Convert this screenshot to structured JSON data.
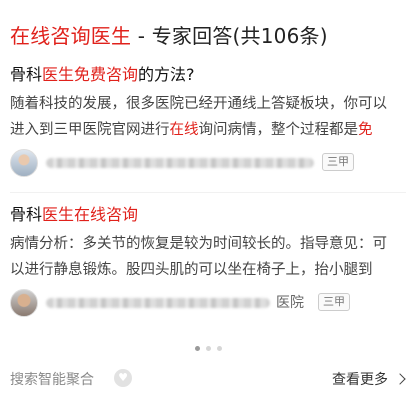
{
  "header": {
    "title_highlight": "在线咨询医生",
    "title_rest": " - 专家回答(共106条)"
  },
  "cards": [
    {
      "question_prefix": "骨科",
      "question_highlight": "医生免费咨询",
      "question_suffix": "的方法?",
      "line1": "随着科技的发展，很多医院已经开通线上答疑板块，你可以",
      "line2_a": "进入到三甲医院官网进行",
      "line2_hl": "在线",
      "line2_b": "询问病情，整个过程都是",
      "line2_hl2": "免",
      "hospital_suffix": "",
      "badge": "三甲"
    },
    {
      "question_prefix": "骨科",
      "question_highlight": "医生在线咨询",
      "question_suffix": "",
      "line1": "病情分析：多关节的恢复是较为时间较长的。指导意见：可",
      "line2_a": "以进行静息锻炼。股四头肌的可以坐在椅子上，抬小腿到",
      "hospital_suffix": "医院",
      "badge": "三甲"
    }
  ],
  "pagination": {
    "total": 3,
    "active": 0
  },
  "footer": {
    "aggregation_label": "搜索智能聚合",
    "more_label": "查看更多"
  },
  "colors": {
    "highlight": "#e0211b"
  }
}
